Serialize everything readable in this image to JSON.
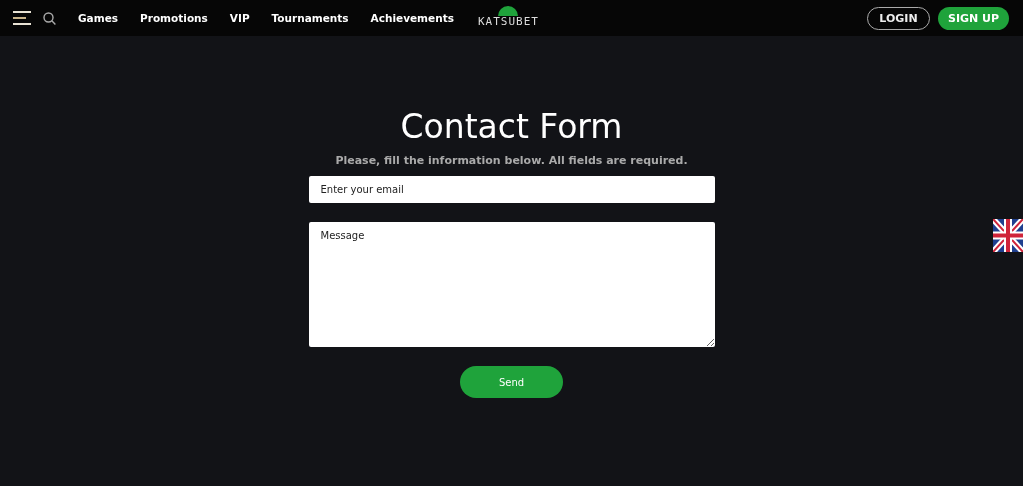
{
  "nav": {
    "links": [
      {
        "label": "Games"
      },
      {
        "label": "Promotions"
      },
      {
        "label": "VIP"
      },
      {
        "label": "Tournaments"
      },
      {
        "label": "Achievements"
      }
    ]
  },
  "logo": {
    "text": "KATSUBET"
  },
  "auth": {
    "login": "LOGIN",
    "signup": "SIGN UP"
  },
  "form": {
    "title": "Contact Form",
    "subtitle": "Please, fill the information below. All fields are required.",
    "email": {
      "placeholder": "Enter your email"
    },
    "message": {
      "placeholder": "Message"
    },
    "submit": "Send"
  }
}
